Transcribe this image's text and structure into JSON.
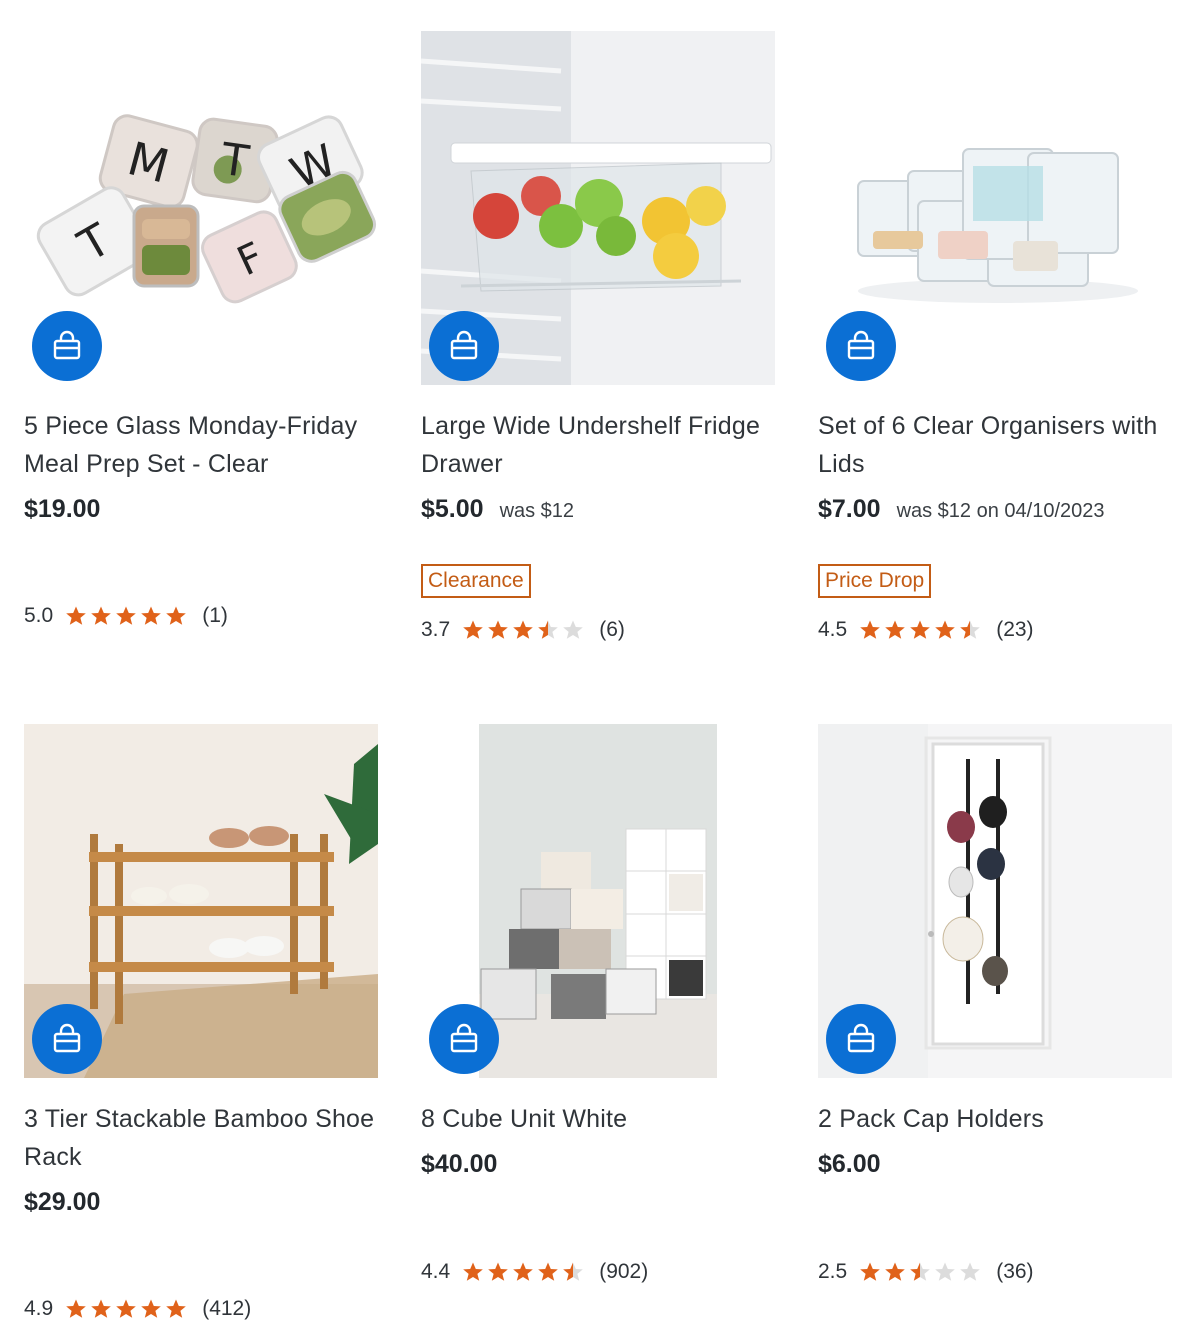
{
  "colors": {
    "accent": "#0b6fd4",
    "star": "#e0621a",
    "star_empty": "#dcdcdc",
    "badge": "#c35c15"
  },
  "cart_icon": "shopping-bag-icon",
  "products": [
    {
      "title": "5 Piece Glass Monday-Friday Meal Prep Set - Clear",
      "price": "$19.00",
      "was": "",
      "badge": "",
      "rating": "5.0",
      "stars": 5.0,
      "count": "(1)",
      "image": "meal-prep-containers"
    },
    {
      "title": "Large Wide Undershelf Fridge Drawer",
      "price": "$5.00",
      "was": "was $12",
      "badge": "Clearance",
      "rating": "3.7",
      "stars": 3.7,
      "count": "(6)",
      "image": "fridge-drawer"
    },
    {
      "title": "Set of 6 Clear Organisers with Lids",
      "price": "$7.00",
      "was": "was $12 on 04/10/2023",
      "badge": "Price Drop",
      "rating": "4.5",
      "stars": 4.5,
      "count": "(23)",
      "image": "clear-organisers"
    },
    {
      "title": "3 Tier Stackable Bamboo Shoe Rack",
      "price": "$29.00",
      "was": "",
      "badge": "",
      "rating": "4.9",
      "stars": 4.9,
      "count": "(412)",
      "image": "bamboo-shoe-rack"
    },
    {
      "title": "8 Cube Unit White",
      "price": "$40.00",
      "was": "",
      "badge": "",
      "rating": "4.4",
      "stars": 4.4,
      "count": "(902)",
      "image": "cube-unit"
    },
    {
      "title": "2 Pack Cap Holders",
      "price": "$6.00",
      "was": "",
      "badge": "",
      "rating": "2.5",
      "stars": 2.5,
      "count": "(36)",
      "image": "cap-holders"
    }
  ]
}
